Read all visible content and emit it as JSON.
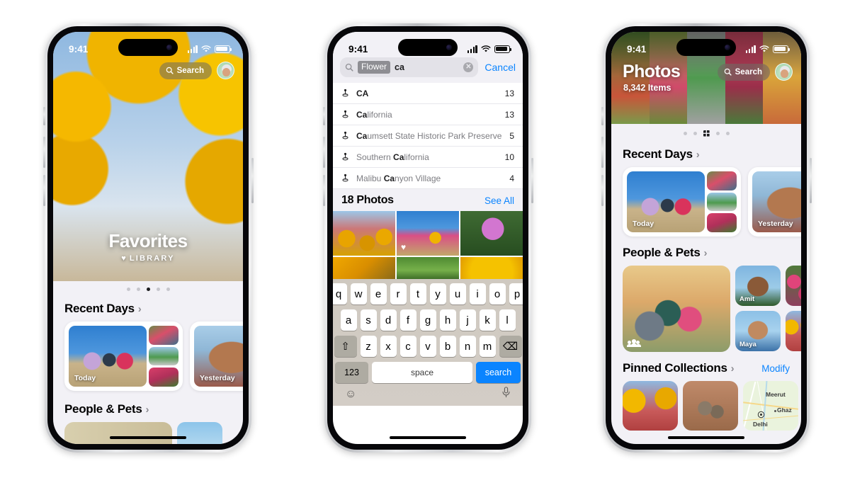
{
  "page": {
    "title": "Apple Photos app on three iPhone screens",
    "background": "#ffffff"
  },
  "status_bar": {
    "time": "9:41",
    "cellular": "signal-bars",
    "wifi": "wifi-icon",
    "battery": "battery-full"
  },
  "phone1": {
    "label": "iPhone showing Photos library Favorites view",
    "hero": {
      "title": "Favorites",
      "subtitle": "LIBRARY",
      "heart": "♥"
    },
    "search_pill": "Search",
    "page_dots": {
      "count": 5,
      "active_index": 2
    },
    "sections": [
      {
        "title": "Recent Days",
        "chevron": "›"
      },
      {
        "title": "People & Pets",
        "chevron": "›"
      }
    ],
    "recent_days": [
      {
        "label": "Today"
      },
      {
        "label": "Yesterday"
      }
    ]
  },
  "phone2": {
    "label": "iPhone showing Photos search with keyboard",
    "search": {
      "token": "Flower",
      "typed_text": "ca",
      "placeholder": "Search",
      "cancel_label": "Cancel",
      "clear_icon": "✕"
    },
    "suggestions": [
      {
        "icon": "location-pin-icon",
        "bold": "CA",
        "rest": "",
        "count": "13"
      },
      {
        "icon": "location-pin-icon",
        "bold": "Ca",
        "rest": "lifornia",
        "count": "13"
      },
      {
        "icon": "location-pin-icon",
        "bold": "Ca",
        "rest": "umsett State Historic Park Preserve",
        "count": "5"
      },
      {
        "icon": "location-pin-icon",
        "pre": "Southern ",
        "bold": "Ca",
        "rest": "lifornia",
        "count": "10"
      },
      {
        "icon": "location-pin-icon",
        "pre": "Malibu ",
        "bold": "Ca",
        "rest": "nyon Village",
        "count": "4"
      }
    ],
    "results": {
      "title": "18 Photos",
      "see_all": "See All"
    },
    "keyboard": {
      "row1": [
        "q",
        "w",
        "e",
        "r",
        "t",
        "y",
        "u",
        "i",
        "o",
        "p"
      ],
      "row2": [
        "a",
        "s",
        "d",
        "f",
        "g",
        "h",
        "j",
        "k",
        "l"
      ],
      "row3": [
        "z",
        "x",
        "c",
        "v",
        "b",
        "n",
        "m"
      ],
      "shift_icon": "⇧",
      "backspace_icon": "⌫",
      "numbers_key": "123",
      "space_key": "space",
      "return_key": "search",
      "emoji_icon": "emoji-icon",
      "mic_icon": "microphone-icon"
    }
  },
  "phone3": {
    "label": "iPhone showing Photos library grid view",
    "hero": {
      "title": "Photos",
      "item_count": "8,342 Items"
    },
    "search_pill": "Search",
    "page_dots": {
      "count": 5,
      "active_index": 2,
      "active_style": "grid"
    },
    "sections": [
      {
        "title": "Recent Days",
        "chevron": "›",
        "action": ""
      },
      {
        "title": "People & Pets",
        "chevron": "›",
        "action": ""
      },
      {
        "title": "Pinned Collections",
        "chevron": "›",
        "action": "Modify"
      }
    ],
    "recent_days": [
      {
        "label": "Today"
      },
      {
        "label": "Yesterday"
      }
    ],
    "people": [
      {
        "name": "Amit"
      },
      {
        "name": "Maya"
      }
    ],
    "map_labels": {
      "city1": "Meerut",
      "city2": "Ghaz",
      "city3": "Delhi"
    }
  },
  "colors": {
    "accent_blue": "#0a84ff",
    "chrome_bg": "#f2f1f6",
    "keyboard_bg": "#cfc9c0",
    "token_gray": "#8e8e93",
    "text_primary": "#1c1c1e",
    "text_secondary": "#7c7c81"
  }
}
